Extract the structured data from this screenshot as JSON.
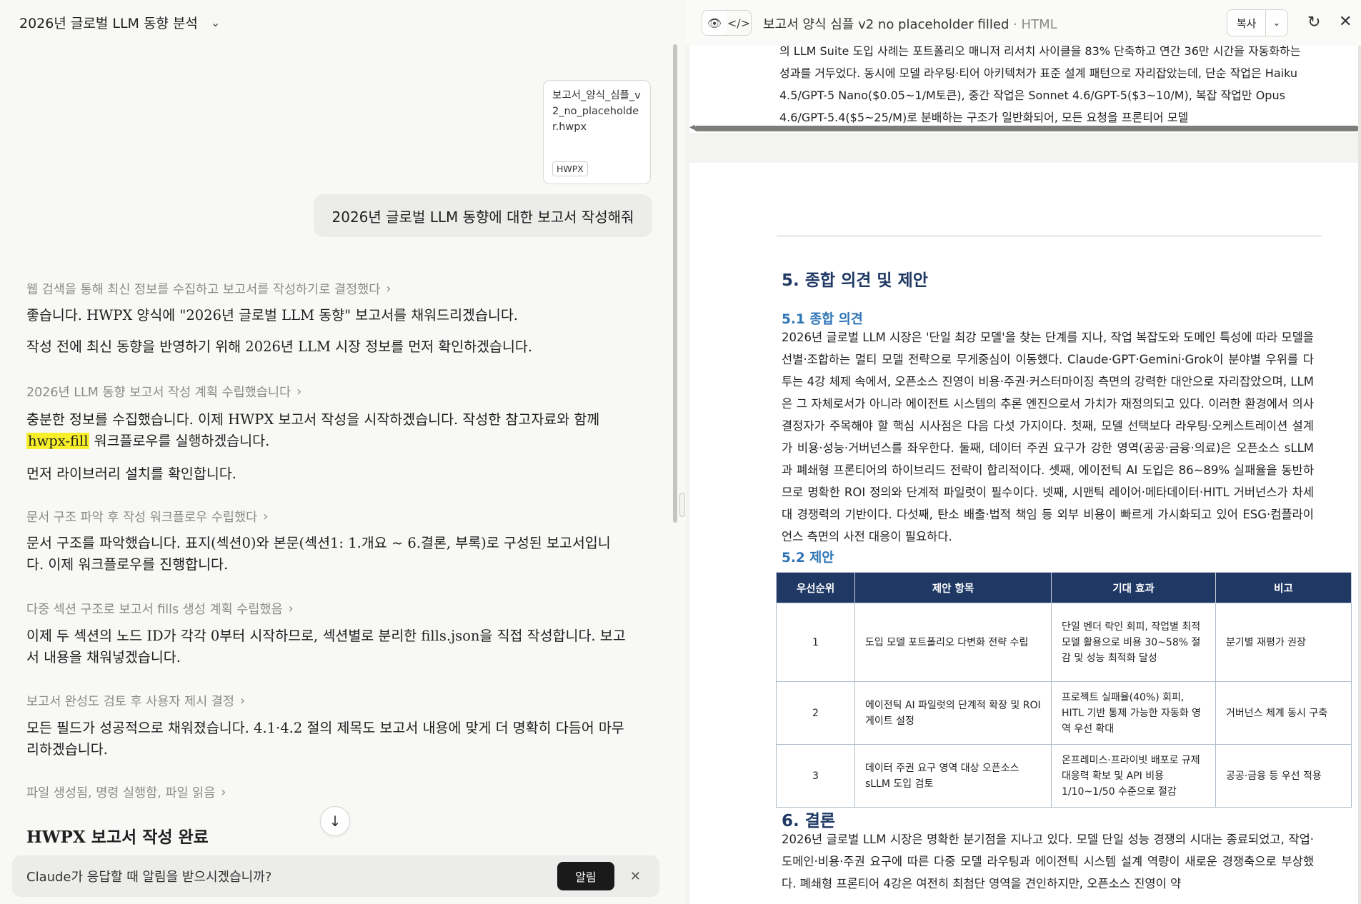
{
  "left": {
    "conversation_title": "2026년 글로벌 LLM 동향 분석",
    "attachment": {
      "filename": "보고서_양식_심플_v2_no_placeholder.hwpx",
      "type_badge": "HWPX"
    },
    "user_message": "2026년 글로벌 LLM 동향에 대한 보고서 작성해줘",
    "steps": [
      "웹 검색을 통해 최신 정보를 수집하고 보고서를 작성하기로 결정했다",
      "2026년 LLM 동향 보고서 작성 계획 수립했습니다",
      "문서 구조 파악 후 작성 워크플로우 수립했다",
      "다중 섹션 구조로 보고서 fills 생성 계획 수립했음",
      "보고서 완성도 검토 후 사용자 제시 결정",
      "파일 생성됨, 명령 실행함, 파일 읽음"
    ],
    "paragraphs": {
      "p1": "좋습니다. HWPX 양식에 \"2026년 글로벌 LLM 동향\" 보고서를 채워드리겠습니다.",
      "p2": "작성 전에 최신 동향을 반영하기 위해 2026년 LLM 시장 정보를 먼저 확인하겠습니다.",
      "p3_before": "충분한 정보를 수집했습니다. 이제 HWPX 보고서 작성을 시작하겠습니다. 작성한 참고자료와 함께 ",
      "p3_highlight": "hwpx-fill",
      "p3_after": " 워크플로우를 실행하겠습니다.",
      "p4": "먼저 라이브러리 설치를 확인합니다.",
      "p5": "문서 구조를 파악했습니다. 표지(섹션0)와 본문(섹션1: 1.개요 ~ 6.결론, 부록)로 구성된 보고서입니다. 이제 워크플로우를 진행합니다.",
      "p6": "이제 두 섹션의 노드 ID가 각각 0부터 시작하므로, 섹션별로 분리한 fills.json을 직접 작성합니다. 보고서 내용을 채워넣겠습니다.",
      "p7": "모든 필드가 성공적으로 채워졌습니다. 4.1·4.2 절의 제목도 보고서 내용에 맞게 더 명확히 다듬어 마무리하겠습니다."
    },
    "done_title": "HWPX 보고서 작성 완료",
    "notify": {
      "text": "Claude가 응답할 때 알림을 받으시겠습니까?",
      "button": "알림"
    }
  },
  "right": {
    "doc_title": "보고서 양식 심플 v2 no placeholder filled",
    "doc_ext": " · HTML",
    "copy_label": "복사",
    "prev_page_text": "의 LLM Suite 도입 사례는 포트폴리오 매니저 리서치 사이클을 83% 단축하고 연간 36만 시간을 자동화하는 성과를 거두었다. 동시에 모델 라우팅·티어 아키텍처가 표준 설계 패턴으로 자리잡았는데, 단순 작업은 Haiku 4.5/GPT-5 Nano($0.05~1/M토큰), 중간 작업은 Sonnet 4.6/GPT-5($3~10/M), 복잡 작업만 Opus 4.6/GPT-5.4($5~25/M)로 분배하는 구조가 일반화되어, 모든 요청을 프론티어 모델",
    "section5": {
      "heading": "5. 종합 의견 및 제안",
      "sub1": "5.1 종합 의견",
      "sub1_text": "2026년 글로벌 LLM 시장은 '단일 최강 모델'을 찾는 단계를 지나, 작업 복잡도와 도메인 특성에 따라 모델을 선별·조합하는 멀티 모델 전략으로 무게중심이 이동했다. Claude·GPT·Gemini·Grok이 분야별 우위를 다투는 4강 체제 속에서, 오픈소스 진영이 비용·주권·커스터마이징 측면의 강력한 대안으로 자리잡았으며, LLM은 그 자체로서가 아니라 에이전트 시스템의 추론 엔진으로서 가치가 재정의되고 있다. 이러한 환경에서 의사결정자가 주목해야 할 핵심 시사점은 다음 다섯 가지이다. 첫째, 모델 선택보다 라우팅·오케스트레이션 설계가 비용·성능·거버넌스를 좌우한다. 둘째, 데이터 주권 요구가 강한 영역(공공·금융·의료)은 오픈소스 sLLM과 폐쇄형 프론티어의 하이브리드 전략이 합리적이다. 셋째, 에이전틱 AI 도입은 86~89% 실패율을 동반하므로 명확한 ROI 정의와 단계적 파일럿이 필수이다. 넷째, 시맨틱 레이어·메타데이터·HITL 거버넌스가 차세대 경쟁력의 기반이다. 다섯째, 탄소 배출·법적 책임 등 외부 비용이 빠르게 가시화되고 있어 ESG·컴플라이언스 측면의 사전 대응이 필요하다.",
      "sub2": "5.2 제안",
      "table_headers": [
        "우선순위",
        "제안 항목",
        "기대 효과",
        "비고"
      ],
      "table_rows": [
        [
          "1",
          "도입 모델 포트폴리오 다변화 전략 수립",
          "단일 벤더 락인 회피, 작업별 최적 모델 활용으로 비용 30~58% 절감 및 성능 최적화 달성",
          "분기별 재평가 권장"
        ],
        [
          "2",
          "에이전틱 AI 파일럿의 단계적 확장 및 ROI 게이트 설정",
          "프로젝트 실패율(40%) 회피, HITL 기반 통제 가능한 자동화 영역 우선 확대",
          "거버넌스 체계 동시 구축"
        ],
        [
          "3",
          "데이터 주권 요구 영역 대상 오픈소스 sLLM 도입 검토",
          "온프레미스·프라이빗 배포로 규제 대응력 확보 및 API 비용 1/10~1/50 수준으로 절감",
          "공공·금융 등 우선 적용"
        ]
      ]
    },
    "section6": {
      "heading": "6. 결론",
      "text": "2026년 글로벌 LLM 시장은 명확한 분기점을 지나고 있다. 모델 단일 성능 경쟁의 시대는 종료되었고, 작업·도메인·비용·주권 요구에 따른 다중 모델 라우팅과 에이전틱 시스템 설계 역량이 새로운 경쟁축으로 부상했다. 폐쇄형 프론티어 4강은 여전히 최첨단 영역을 견인하지만, 오픈소스 진영이 약"
    }
  }
}
